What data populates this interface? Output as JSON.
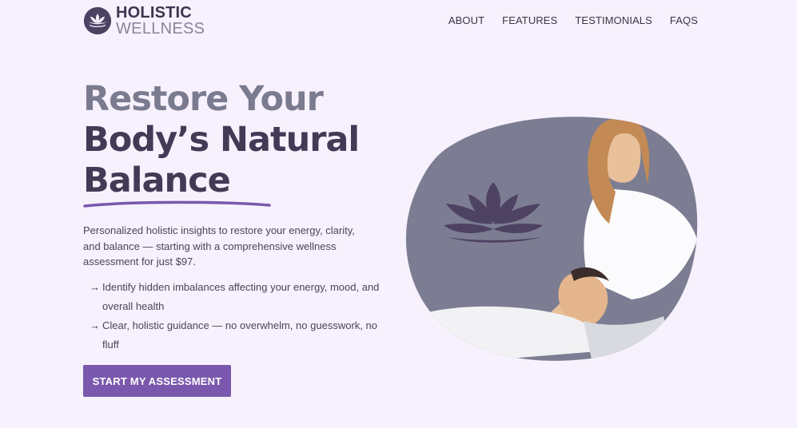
{
  "brand": {
    "line1": "HOLISTIC",
    "line2": "WELLNESS"
  },
  "nav": [
    {
      "label": "ABOUT"
    },
    {
      "label": "FEATURES"
    },
    {
      "label": "TESTIMONIALS"
    },
    {
      "label": "FAQS"
    }
  ],
  "hero": {
    "title_line1": "Restore Your",
    "title_line2": "Body’s Natural",
    "title_line3": "Balance",
    "description": "Personalized holistic insights to restore your energy, clarity, and balance — starting with a comprehensive wellness assessment for just $97.",
    "bullets": [
      "Identify hidden imbalances affecting your energy, mood, and overall health",
      "Clear, holistic guidance — no overwhelm, no guesswork, no fluff"
    ],
    "cta_label": "START MY ASSESSMENT"
  },
  "colors": {
    "background": "#f7f1fd",
    "accent": "#7a58ad",
    "heading": "#433a56",
    "heading_muted": "#7b7b8f",
    "blob": "#7c7d92",
    "lotus": "#4e4263"
  },
  "icons": [
    "lotus-logo-icon",
    "arrow-right-icon",
    "lotus-icon"
  ]
}
